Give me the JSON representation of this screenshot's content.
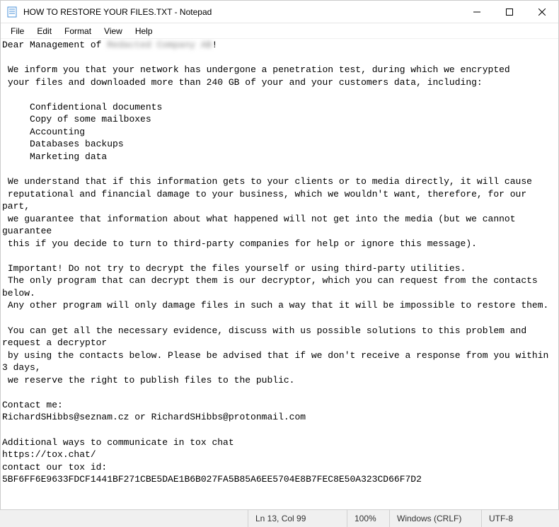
{
  "window": {
    "title": "HOW TO RESTORE YOUR FILES.TXT - Notepad"
  },
  "menu": {
    "file": "File",
    "edit": "Edit",
    "format": "Format",
    "view": "View",
    "help": "Help"
  },
  "document": {
    "greeting_prefix": "Dear Management of ",
    "greeting_redacted": "Redacted Company AB",
    "greeting_suffix": "!",
    "p1": " We inform you that your network has undergone a penetration test, during which we encrypted",
    "p2": " your files and downloaded more than 240 GB of your and your customers data, including:",
    "list1": "     Confidentional documents",
    "list2": "     Copy of some mailboxes",
    "list3": "     Accounting",
    "list4": "     Databases backups",
    "list5": "     Marketing data",
    "p3": " We understand that if this information gets to your clients or to media directly, it will cause",
    "p4": " reputational and financial damage to your business, which we wouldn't want, therefore, for our part,",
    "p5": " we guarantee that information about what happened will not get into the media (but we cannot guarantee",
    "p6": " this if you decide to turn to third-party companies for help or ignore this message).",
    "p7": " Important! Do not try to decrypt the files yourself or using third-party utilities.",
    "p8": " The only program that can decrypt them is our decryptor, which you can request from the contacts below.",
    "p9": " Any other program will only damage files in such a way that it will be impossible to restore them.",
    "p10": " You can get all the necessary evidence, discuss with us possible solutions to this problem and request a decryptor",
    "p11": " by using the contacts below. Please be advised that if we don't receive a response from you within 3 days,",
    "p12": " we reserve the right to publish files to the public.",
    "contact_header": "Contact me:",
    "contact_line": "RichardSHibbs@seznam.cz or RichardSHibbs@protonmail.com",
    "tox_header": "Additional ways to communicate in tox chat",
    "tox_url": "https://tox.chat/",
    "tox_id_label": "contact our tox id:",
    "tox_id": "5BF6FF6E9633FDCF1441BF271CBE5DAE1B6B027FA5B85A6EE5704E8B7FEC8E50A323CD66F7D2"
  },
  "status": {
    "position": "Ln 13, Col 99",
    "zoom": "100%",
    "line_ending": "Windows (CRLF)",
    "encoding": "UTF-8"
  }
}
